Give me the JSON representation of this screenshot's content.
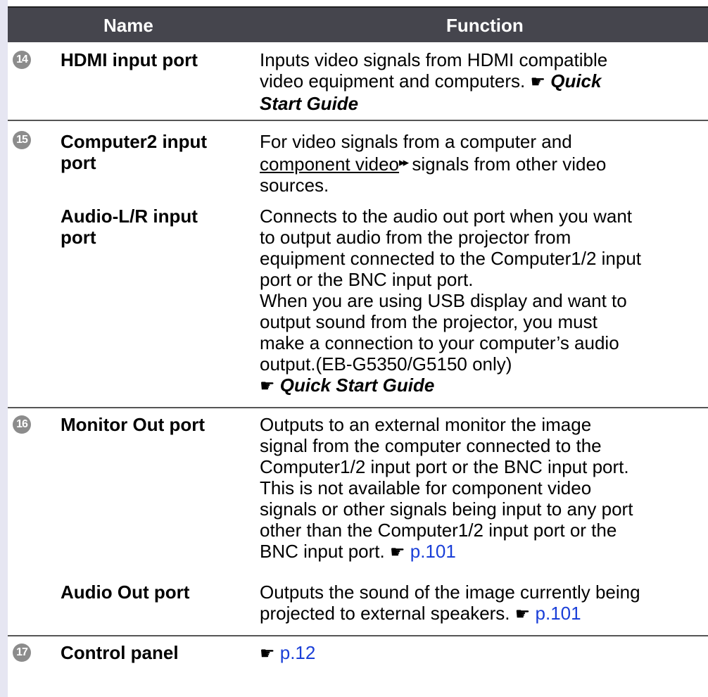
{
  "header": {
    "name": "Name",
    "function": "Function"
  },
  "rows": {
    "r14": {
      "num": "14",
      "name": "HDMI input port",
      "l1": "Inputs video signals from HDMI compatible",
      "l2a": "video equipment and computers.",
      "l2b": "Quick",
      "l3": "Start Guide"
    },
    "r15": {
      "num": "15",
      "name": "Computer2 input port",
      "l1": "For video signals from a computer and",
      "l2a": "component video",
      "l2b": "signals from other video",
      "l3": "sources."
    },
    "r15b": {
      "name": "Audio-L/R input port",
      "lines": [
        "Connects to the audio out port when you want",
        "to output audio from the projector from",
        "equipment connected to the Computer1/2 input",
        "port or the BNC input port.",
        "When you are using USB display and want to",
        "output sound from the projector, you must",
        "make a connection to your computer’s audio",
        "output.(EB-G5350/G5150 only)"
      ],
      "guide": "Quick Start Guide"
    },
    "r16": {
      "num": "16",
      "name": "Monitor Out port",
      "lines": [
        "Outputs to an external monitor the image",
        "signal from the computer connected to the",
        "Computer1/2 input port or the BNC input port.",
        "This is not available for component video",
        "signals or other signals being input to any port",
        "other than the Computer1/2 input port or the"
      ],
      "l7": "BNC input port.",
      "link": "p.101"
    },
    "r16b": {
      "name": "Audio Out port",
      "l1": "Outputs the sound of the image currently being",
      "l2": "projected to external speakers.",
      "link": "p.101"
    },
    "r17": {
      "num": "17",
      "name": "Control panel",
      "link": "p.12"
    }
  },
  "icons": {
    "pointer": "pointing-hand-icon",
    "glossary": "double-arrow-icon"
  },
  "colors": {
    "header_bg": "#45454d",
    "link": "#1a3fd8",
    "badge": "#8c8c8c"
  }
}
